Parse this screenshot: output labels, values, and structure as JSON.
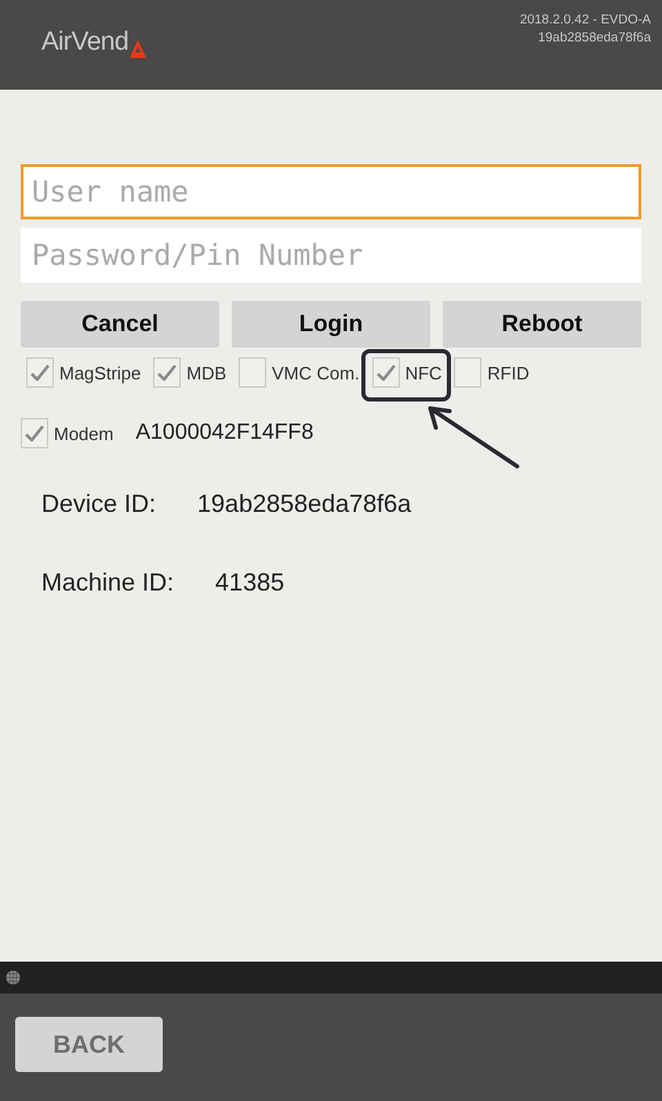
{
  "header": {
    "logo": "AirVend",
    "version": "2018.2.0.42 - EVDO-A",
    "device": "19ab2858eda78f6a"
  },
  "login": {
    "username": {
      "placeholder": "User name",
      "focused": true
    },
    "password": {
      "placeholder": "Password/Pin Number"
    }
  },
  "buttons": [
    "Cancel",
    "Login",
    "Reboot"
  ],
  "options": [
    {
      "label": "MagStripe",
      "checked": true
    },
    {
      "label": "MDB",
      "checked": true
    },
    {
      "label": "VMC Com.",
      "checked": false
    },
    {
      "label": "NFC",
      "checked": true,
      "highlighted": true
    },
    {
      "label": "RFID",
      "checked": false
    }
  ],
  "modem": {
    "label": "Modem",
    "checked": true,
    "value": "A1000042F14FF8"
  },
  "info": [
    {
      "label": "Device ID:",
      "value": "19ab2858eda78f6a"
    },
    {
      "label": "Machine ID:",
      "value": "41385"
    }
  ],
  "footer": {
    "back": "BACK"
  }
}
